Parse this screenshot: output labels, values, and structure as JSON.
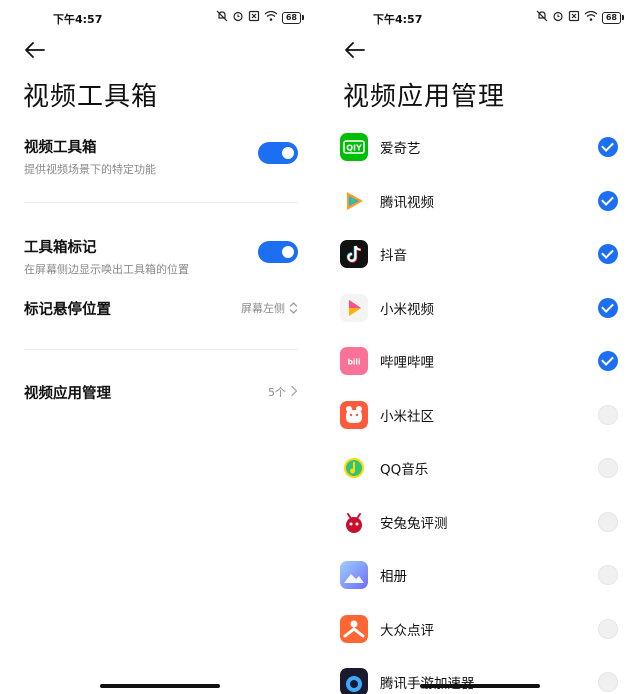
{
  "status": {
    "time": "下午4:57",
    "battery": "68"
  },
  "left": {
    "title": "视频工具箱",
    "toolbox": {
      "label": "视频工具箱",
      "sub": "提供视频场景下的特定功能",
      "on": true
    },
    "marker": {
      "label": "工具箱标记",
      "sub": "在屏幕侧边显示唤出工具箱的位置",
      "on": true
    },
    "hover": {
      "label": "标记悬停位置",
      "value": "屏幕左侧"
    },
    "manage": {
      "label": "视频应用管理",
      "value": "5个"
    }
  },
  "right": {
    "title": "视频应用管理",
    "apps": [
      {
        "name": "爱奇艺",
        "icon": "iqiyi-icon",
        "color": "#00be06",
        "checked": true
      },
      {
        "name": "腾讯视频",
        "icon": "tencent-video-icon",
        "color": "#ffffff",
        "checked": true
      },
      {
        "name": "抖音",
        "icon": "douyin-icon",
        "color": "#111111",
        "checked": true
      },
      {
        "name": "小米视频",
        "icon": "mi-video-icon",
        "color": "#f4f4f4",
        "checked": true
      },
      {
        "name": "哔哩哔哩",
        "icon": "bilibili-icon",
        "color": "#fb7299",
        "checked": true
      },
      {
        "name": "小米社区",
        "icon": "mi-community-icon",
        "color": "#ff5a3c",
        "checked": false
      },
      {
        "name": "QQ音乐",
        "icon": "qq-music-icon",
        "color": "#ffffff",
        "checked": false
      },
      {
        "name": "安兔兔评测",
        "icon": "antutu-icon",
        "color": "#ffffff",
        "checked": false
      },
      {
        "name": "相册",
        "icon": "gallery-icon",
        "color": "#7a8cff",
        "checked": false
      },
      {
        "name": "大众点评",
        "icon": "dianping-icon",
        "color": "#ff6633",
        "checked": false
      },
      {
        "name": "腾讯手游加速器",
        "icon": "game-accelerator-icon",
        "color": "#1a1a2e",
        "checked": false
      }
    ]
  }
}
